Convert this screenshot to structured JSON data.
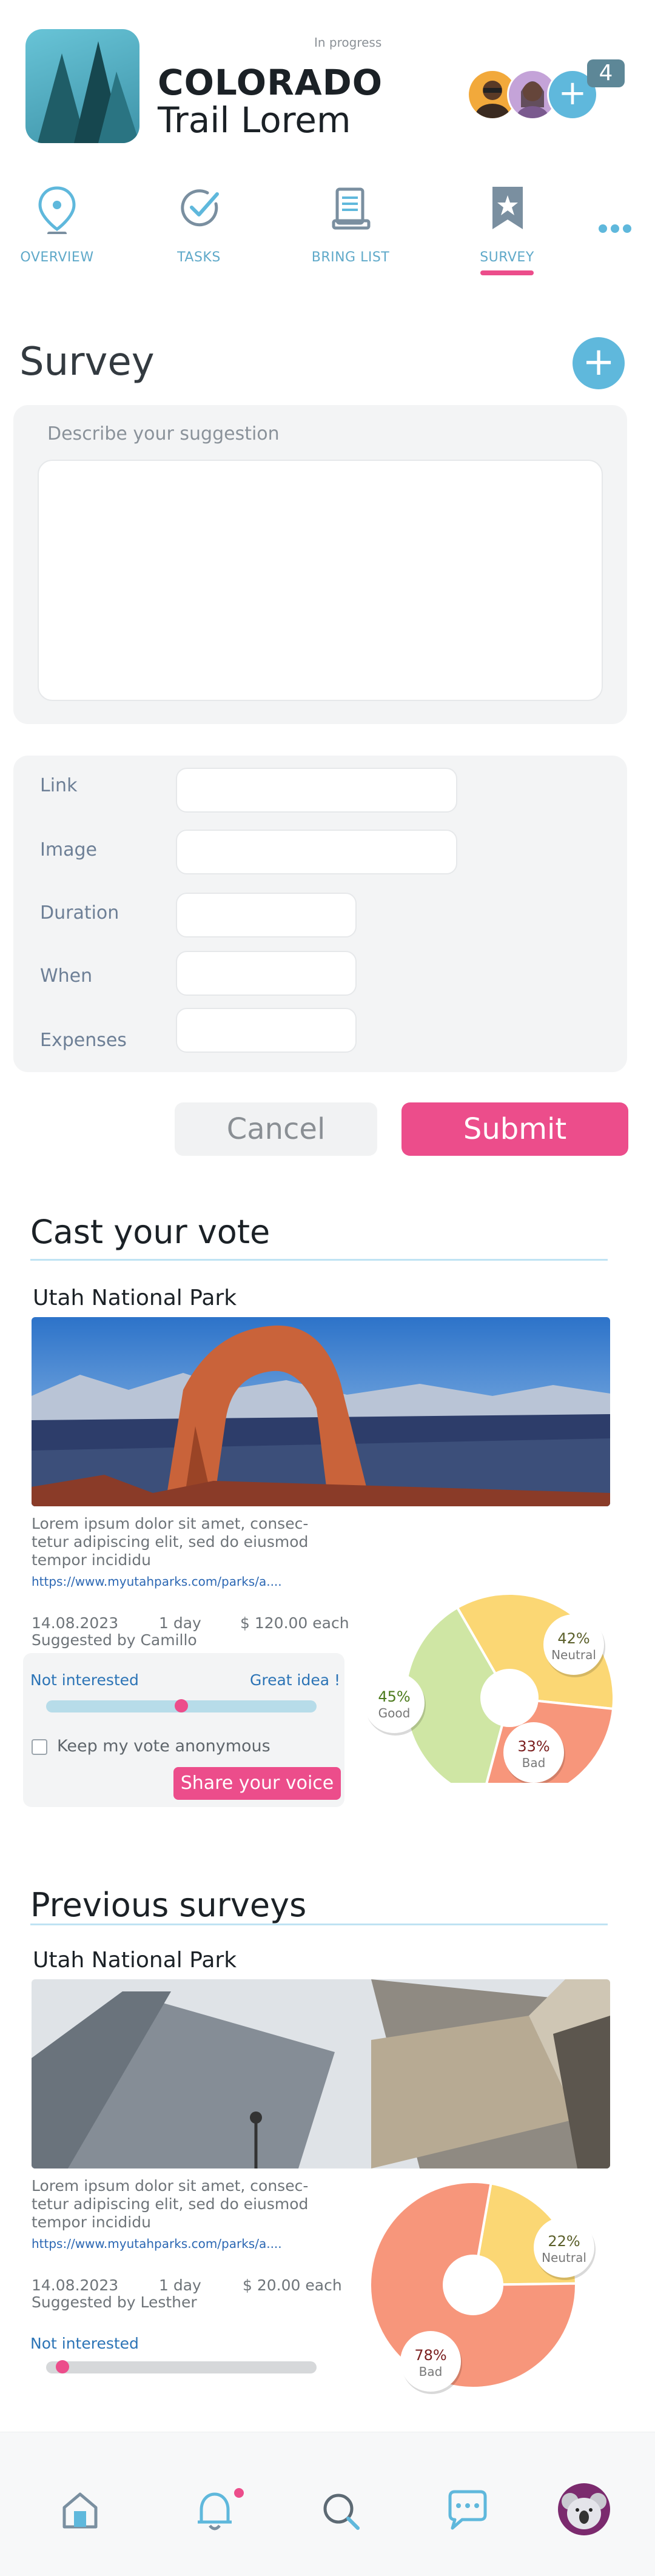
{
  "header": {
    "status": "In progress",
    "title_line1": "COLORADO",
    "title_line2": "Trail Lorem",
    "member_count": "4"
  },
  "tabs": [
    {
      "label": "OVERVIEW",
      "icon": "map-pin-icon"
    },
    {
      "label": "TASKS",
      "icon": "check-circle-icon"
    },
    {
      "label": "BRING LIST",
      "icon": "document-icon"
    },
    {
      "label": "SURVEY",
      "icon": "bookmark-star-icon",
      "active": true
    }
  ],
  "survey": {
    "title": "Survey",
    "suggestion_placeholder": "Describe your suggestion",
    "fields": [
      {
        "label": "Link",
        "value": ""
      },
      {
        "label": "Image",
        "value": ""
      },
      {
        "label": "Duration",
        "value": ""
      },
      {
        "label": "When",
        "value": ""
      },
      {
        "label": "Expenses",
        "value": ""
      }
    ],
    "cancel_label": "Cancel",
    "submit_label": "Submit"
  },
  "vote": {
    "section_title": "Cast your vote",
    "place": "Utah National Park",
    "description": [
      "Lorem ipsum dolor sit amet, consec-",
      "tetur adipiscing elit, sed do eiusmod",
      "tempor incididu"
    ],
    "url": "https://www.myutahparks.com/parks/a....",
    "date": "14.08.2023",
    "duration": "1 day",
    "price": "$ 120.00 each",
    "suggested_by": "Suggested by Camillo",
    "scale_left": "Not interested",
    "scale_right": "Great idea !",
    "slider_level": 0.5,
    "anonymous_label": "Keep my vote anonymous",
    "anonymous_checked": false,
    "share_label": "Share your voice",
    "results": [
      {
        "label": "Neutral",
        "percent": "42%",
        "value": 42,
        "color": "#fbd774"
      },
      {
        "label": "Bad",
        "percent": "33%",
        "value": 33,
        "color": "#f7967b"
      },
      {
        "label": "Good",
        "percent": "45%",
        "value": 45,
        "color": "#cfe6a4"
      }
    ]
  },
  "previous": {
    "section_title": "Previous surveys",
    "place": "Utah National Park",
    "description": [
      "Lorem ipsum dolor sit amet, consec-",
      "tetur adipiscing elit, sed do eiusmod",
      "tempor incididu"
    ],
    "url": "https://www.myutahparks.com/parks/a....",
    "date": "14.08.2023",
    "duration": "1 day",
    "price": "$ 20.00 each",
    "suggested_by": "Suggested by Lesther",
    "scale_left": "Not interested",
    "slider_level": 0.06,
    "results": [
      {
        "label": "Neutral",
        "percent": "22%",
        "value": 22,
        "color": "#fbd774"
      },
      {
        "label": "Bad",
        "percent": "78%",
        "value": 78,
        "color": "#f7967b"
      }
    ]
  },
  "bottom_nav": [
    {
      "icon": "home-icon"
    },
    {
      "icon": "bell-icon"
    },
    {
      "icon": "search-icon"
    },
    {
      "icon": "chat-icon"
    },
    {
      "icon": "profile-avatar"
    }
  ],
  "colors": {
    "accent": "#5fb8dc",
    "pink": "#ec4d8b",
    "panel": "#f3f4f5"
  }
}
